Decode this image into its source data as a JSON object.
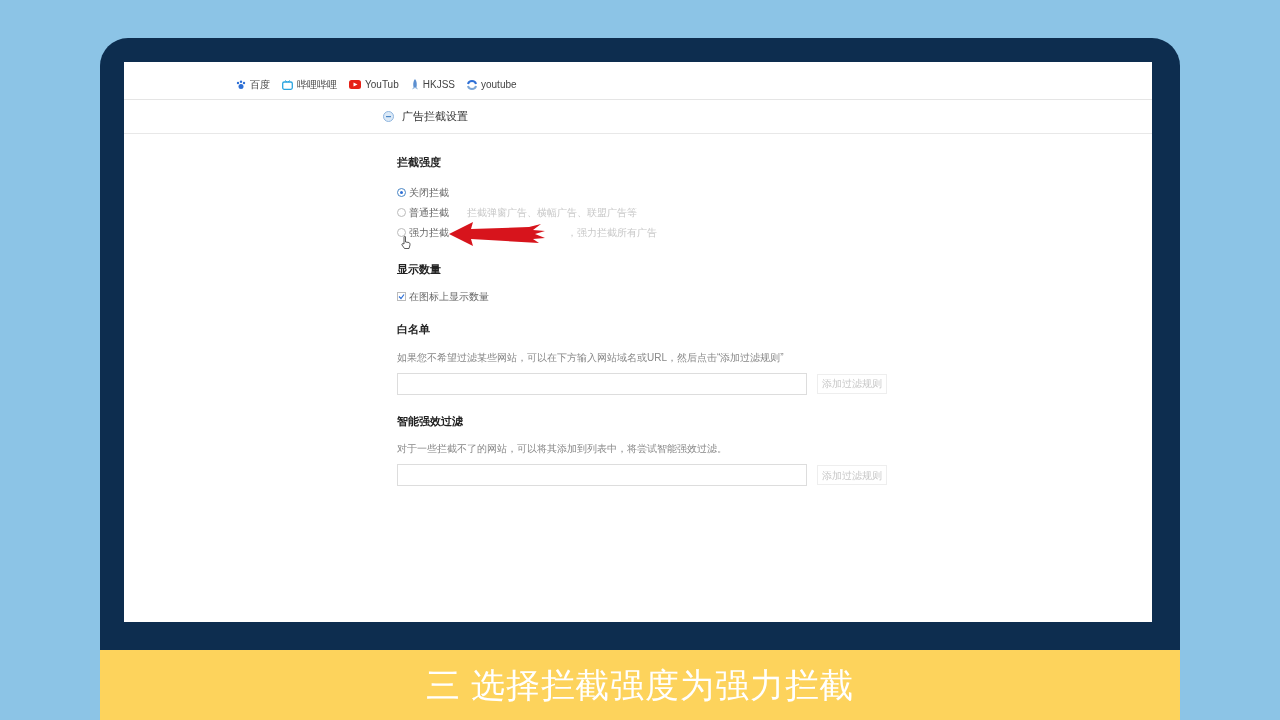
{
  "bookmarks": [
    {
      "label": "百度",
      "kind": "paw"
    },
    {
      "label": "哔哩哔哩",
      "kind": "tv"
    },
    {
      "label": "YouTub",
      "kind": "play"
    },
    {
      "label": "HKJSS",
      "kind": "rocket"
    },
    {
      "label": "youtube",
      "kind": "swirl"
    }
  ],
  "page": {
    "title": "广告拦截设置"
  },
  "sections": [
    {
      "kind": "radio",
      "heading": "拦截强度",
      "options": [
        {
          "label": "关闭拦截",
          "selected": true
        },
        {
          "label": "普通拦截",
          "description": "拦截弹窗广告、横幅广告、联盟广告等",
          "selected": false
        },
        {
          "label": "强力拦截",
          "description": "，强力拦截所有广告",
          "selected": false
        }
      ]
    },
    {
      "kind": "checkbox",
      "heading": "显示数量",
      "options": [
        {
          "label": "在图标上显示数量",
          "checked": true
        }
      ]
    },
    {
      "kind": "input",
      "heading": "白名单",
      "description": "如果您不希望过滤某些网站，可以在下方输入网站域名或URL，然后点击“添加过滤规则”",
      "button": "添加过滤规则"
    },
    {
      "kind": "input",
      "heading": "智能强效过滤",
      "description": "对于一些拦截不了的网站，可以将其添加到列表中，将尝试智能强效过滤。",
      "button": "添加过滤规则"
    }
  ],
  "caption": "三 选择拦截强度为强力拦截"
}
